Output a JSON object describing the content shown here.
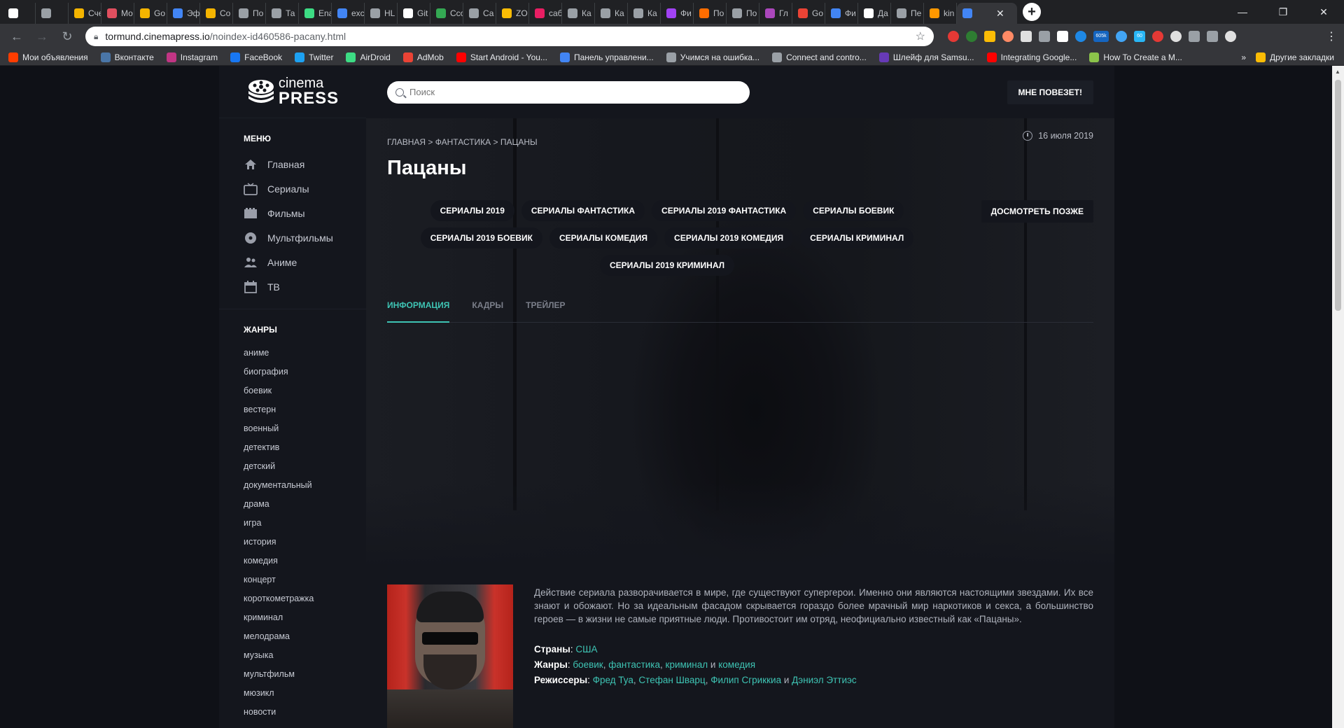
{
  "browser": {
    "tabs": [
      {
        "title": "",
        "color": "#ffffff"
      },
      {
        "title": "",
        "color": "#9aa0a6"
      },
      {
        "title": "Сче",
        "color": "#f4b400"
      },
      {
        "title": "Мо",
        "color": "#e04f5f"
      },
      {
        "title": "Go",
        "color": "#f4b400"
      },
      {
        "title": "Эф",
        "color": "#4285f4"
      },
      {
        "title": "Со",
        "color": "#f4b400"
      },
      {
        "title": "По",
        "color": "#9aa0a6"
      },
      {
        "title": "Та",
        "color": "#9aa0a6"
      },
      {
        "title": "Ena",
        "color": "#3ddc84"
      },
      {
        "title": "exc",
        "color": "#4285f4"
      },
      {
        "title": "HL",
        "color": "#9aa0a6"
      },
      {
        "title": "Git",
        "color": "#ffffff"
      },
      {
        "title": "Ссс",
        "color": "#34a853"
      },
      {
        "title": "Са",
        "color": "#9aa0a6"
      },
      {
        "title": "ZO",
        "color": "#fbbc05"
      },
      {
        "title": "саб",
        "color": "#e91e63"
      },
      {
        "title": "Ка",
        "color": "#9aa0a6"
      },
      {
        "title": "Ка",
        "color": "#9aa0a6"
      },
      {
        "title": "Ка",
        "color": "#9aa0a6"
      },
      {
        "title": "Фи",
        "color": "#a142f4"
      },
      {
        "title": "По",
        "color": "#ff6d00"
      },
      {
        "title": "По",
        "color": "#9aa0a6"
      },
      {
        "title": "Гл",
        "color": "#ab47bc"
      },
      {
        "title": "Go",
        "color": "#ea4335"
      },
      {
        "title": "Фи",
        "color": "#4285f4"
      },
      {
        "title": "Да",
        "color": "#ffffff"
      },
      {
        "title": "Пе",
        "color": "#9aa0a6"
      },
      {
        "title": "kin",
        "color": "#ff9800"
      }
    ],
    "active_tab": {
      "title": "",
      "color": "#4285f4",
      "close": "✕"
    },
    "new_tab": "+",
    "window_controls": [
      "—",
      "❐",
      "✕"
    ],
    "url_host": "tormund.cinemapress.io",
    "url_path": "/noindex-id460586-pacany.html",
    "ext_badges": [
      "605k",
      "60"
    ],
    "bookmarks": [
      {
        "label": "Мои объявления",
        "color": "#ff3d00"
      },
      {
        "label": "Вконтакте",
        "color": "#4a76a8"
      },
      {
        "label": "Instagram",
        "color": "#c13584"
      },
      {
        "label": "FaceBook",
        "color": "#1877f2"
      },
      {
        "label": "Twitter",
        "color": "#1da1f2"
      },
      {
        "label": "AirDroid",
        "color": "#3ddc84"
      },
      {
        "label": "AdMob",
        "color": "#ea4335"
      },
      {
        "label": "Start Android - You...",
        "color": "#ff0000"
      },
      {
        "label": "Панель управлени...",
        "color": "#4285f4"
      },
      {
        "label": "Учимся на ошибка...",
        "color": "#9aa0a6"
      },
      {
        "label": "Connect and contro...",
        "color": "#9aa0a6"
      },
      {
        "label": "Шлейф для Samsu...",
        "color": "#673ab7"
      },
      {
        "label": "Integrating Google...",
        "color": "#ff0000"
      },
      {
        "label": "How To Create a M...",
        "color": "#8bc34a"
      }
    ],
    "bookmarks_more": "»",
    "other_bookmarks": "Другие закладки"
  },
  "site": {
    "logo": {
      "line1": "cinema",
      "line2": "PRESS"
    },
    "search_placeholder": "Поиск",
    "lucky_button": "МНЕ ПОВЕЗЕТ!",
    "menu_heading": "МЕНЮ",
    "menu": [
      {
        "label": "Главная",
        "icon": "home-icon"
      },
      {
        "label": "Сериалы",
        "icon": "tv-icon"
      },
      {
        "label": "Фильмы",
        "icon": "film-icon"
      },
      {
        "label": "Мультфильмы",
        "icon": "disc-icon"
      },
      {
        "label": "Аниме",
        "icon": "people-icon"
      },
      {
        "label": "ТВ",
        "icon": "calendar-icon"
      }
    ],
    "genres_heading": "ЖАНРЫ",
    "genres": [
      "аниме",
      "биография",
      "боевик",
      "вестерн",
      "военный",
      "детектив",
      "детский",
      "документальный",
      "драма",
      "игра",
      "история",
      "комедия",
      "концерт",
      "короткометражка",
      "криминал",
      "мелодрама",
      "музыка",
      "мультфильм",
      "мюзикл",
      "новости"
    ],
    "breadcrumb": [
      "ГЛАВНАЯ",
      ">",
      "ФАНТАСТИКА",
      ">",
      "ПАЦАНЫ"
    ],
    "date": "16 июля 2019",
    "title": "Пацаны",
    "tags": [
      "СЕРИАЛЫ 2019",
      "СЕРИАЛЫ ФАНТАСТИКА",
      "СЕРИАЛЫ 2019 ФАНТАСТИКА",
      "СЕРИАЛЫ БОЕВИК",
      "СЕРИАЛЫ 2019 БОЕВИК",
      "СЕРИАЛЫ КОМЕДИЯ",
      "СЕРИАЛЫ 2019 КОМЕДИЯ",
      "СЕРИАЛЫ КРИМИНАЛ",
      "СЕРИАЛЫ 2019 КРИМИНАЛ"
    ],
    "watch_later": "ДОСМОТРЕТЬ ПОЗЖЕ",
    "content_tabs": [
      "ИНФОРМАЦИЯ",
      "КАДРЫ",
      "ТРЕЙЛЕР"
    ],
    "description": "Действие сериала разворачивается в мире, где существуют супергерои. Именно они являются настоящими звездами. Их все знают и обожают. Но за идеальным фасадом скрывается гораздо более мрачный мир наркотиков и секса, а большинство героев — в жизни не самые приятные люди. Противостоит им отряд, неофициально известный как «Пацаны».",
    "facts": {
      "countries_label": "Страны",
      "countries": [
        "США"
      ],
      "genres_label": "Жанры",
      "genres": [
        "боевик",
        "фантастика",
        "криминал",
        "комедия"
      ],
      "directors_label": "Режиссеры",
      "directors": [
        "Фред Туа",
        "Стефан Шварц",
        "Филип Сгриккиа",
        "Дэниэл Эттиэс"
      ],
      "and_word": "и"
    },
    "accent_color": "#3ec4b4"
  }
}
